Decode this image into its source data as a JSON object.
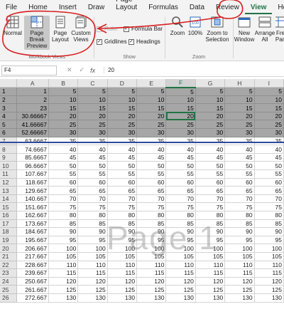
{
  "tabs": [
    "File",
    "Home",
    "Insert",
    "Draw",
    "Page Layout",
    "Formulas",
    "Data",
    "Review",
    "View",
    "Help"
  ],
  "ribbon": {
    "workbook_views": {
      "label": "Workbook Views",
      "normal": "Normal",
      "page_break_preview": "Page Break Preview",
      "page_layout": "Page Layout",
      "custom_views": "Custom Views"
    },
    "show": {
      "label": "Show",
      "ruler": "Ruler",
      "formula_bar": "Formula Bar",
      "gridlines": "Gridlines",
      "headings": "Headings"
    },
    "zoom": {
      "label": "Zoom",
      "zoom": "Zoom",
      "hundred": "100%",
      "zoom_to_selection": "Zoom to Selection"
    },
    "window": {
      "new_window": "New Window",
      "arrange_all": "Arrange All",
      "freeze_panes": "Fre Pan"
    }
  },
  "formula_bar": {
    "name_box": "F4",
    "cancel": "✕",
    "enter": "✓",
    "fx": "fx",
    "value": "20"
  },
  "columns": [
    "A",
    "B",
    "C",
    "D",
    "E",
    "F",
    "G",
    "H",
    "I"
  ],
  "selected_column": "F",
  "selected_row": 4,
  "print_rows": 6,
  "rows": [
    {
      "n": "1",
      "a": "1",
      "v": "5"
    },
    {
      "n": "2",
      "a": "2",
      "v": "10"
    },
    {
      "n": "3",
      "a": "23",
      "v": "15"
    },
    {
      "n": "4",
      "a": "30.66667",
      "v": "20"
    },
    {
      "n": "5",
      "a": "41.66667",
      "v": "25"
    },
    {
      "n": "6",
      "a": "52.66667",
      "v": "30"
    },
    {
      "n": "7",
      "a": "63.6667",
      "v": "35"
    },
    {
      "n": "8",
      "a": "74.6667",
      "v": "40"
    },
    {
      "n": "9",
      "a": "85.6667",
      "v": "45"
    },
    {
      "n": "10",
      "a": "96.6667",
      "v": "50"
    },
    {
      "n": "11",
      "a": "107.667",
      "v": "55"
    },
    {
      "n": "12",
      "a": "118.667",
      "v": "60"
    },
    {
      "n": "13",
      "a": "129.667",
      "v": "65"
    },
    {
      "n": "14",
      "a": "140.667",
      "v": "70"
    },
    {
      "n": "15",
      "a": "151.667",
      "v": "75"
    },
    {
      "n": "16",
      "a": "162.667",
      "v": "80"
    },
    {
      "n": "17",
      "a": "173.667",
      "v": "85"
    },
    {
      "n": "18",
      "a": "184.667",
      "v": "90"
    },
    {
      "n": "19",
      "a": "195.667",
      "v": "95"
    },
    {
      "n": "20",
      "a": "206.667",
      "v": "100"
    },
    {
      "n": "21",
      "a": "217.667",
      "v": "105"
    },
    {
      "n": "22",
      "a": "228.667",
      "v": "110"
    },
    {
      "n": "23",
      "a": "239.667",
      "v": "115"
    },
    {
      "n": "24",
      "a": "250.667",
      "v": "120"
    },
    {
      "n": "25",
      "a": "261.667",
      "v": "125"
    },
    {
      "n": "26",
      "a": "272.667",
      "v": "130"
    }
  ],
  "page_watermark": "Page 1",
  "colors": {
    "accent": "#217346",
    "print_area": "#a6a6a6",
    "page_break": "#2e4b9a",
    "annotation": "#d81f1f"
  }
}
